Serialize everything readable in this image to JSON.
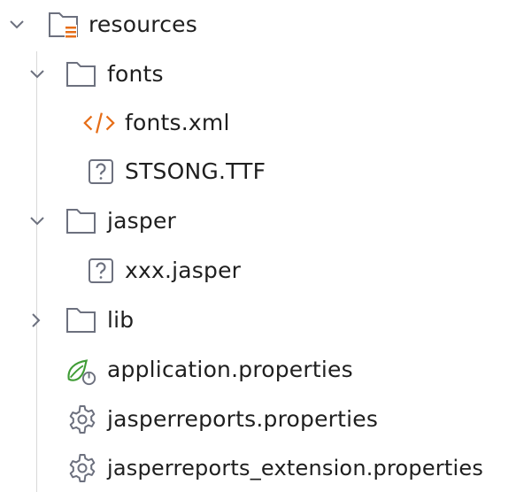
{
  "tree": {
    "items": [
      {
        "label": "resources",
        "icon": "resources-folder-icon",
        "expanded": true
      },
      {
        "label": "fonts",
        "icon": "folder-icon",
        "expanded": true
      },
      {
        "label": "fonts.xml",
        "icon": "xml-file-icon"
      },
      {
        "label": "STSONG.TTF",
        "icon": "unknown-file-icon"
      },
      {
        "label": "jasper",
        "icon": "folder-icon",
        "expanded": true
      },
      {
        "label": "xxx.jasper",
        "icon": "unknown-file-icon"
      },
      {
        "label": "lib",
        "icon": "folder-icon",
        "expanded": false
      },
      {
        "label": "application.properties",
        "icon": "spring-boot-properties-icon"
      },
      {
        "label": "jasperreports.properties",
        "icon": "settings-file-icon"
      },
      {
        "label": "jasperreports_extension.properties",
        "icon": "settings-file-icon"
      }
    ]
  },
  "colors": {
    "text": "#1f1f1f",
    "icon_gray": "#6c707e",
    "xml_orange": "#e66d17",
    "spring_green": "#3f9c35"
  }
}
